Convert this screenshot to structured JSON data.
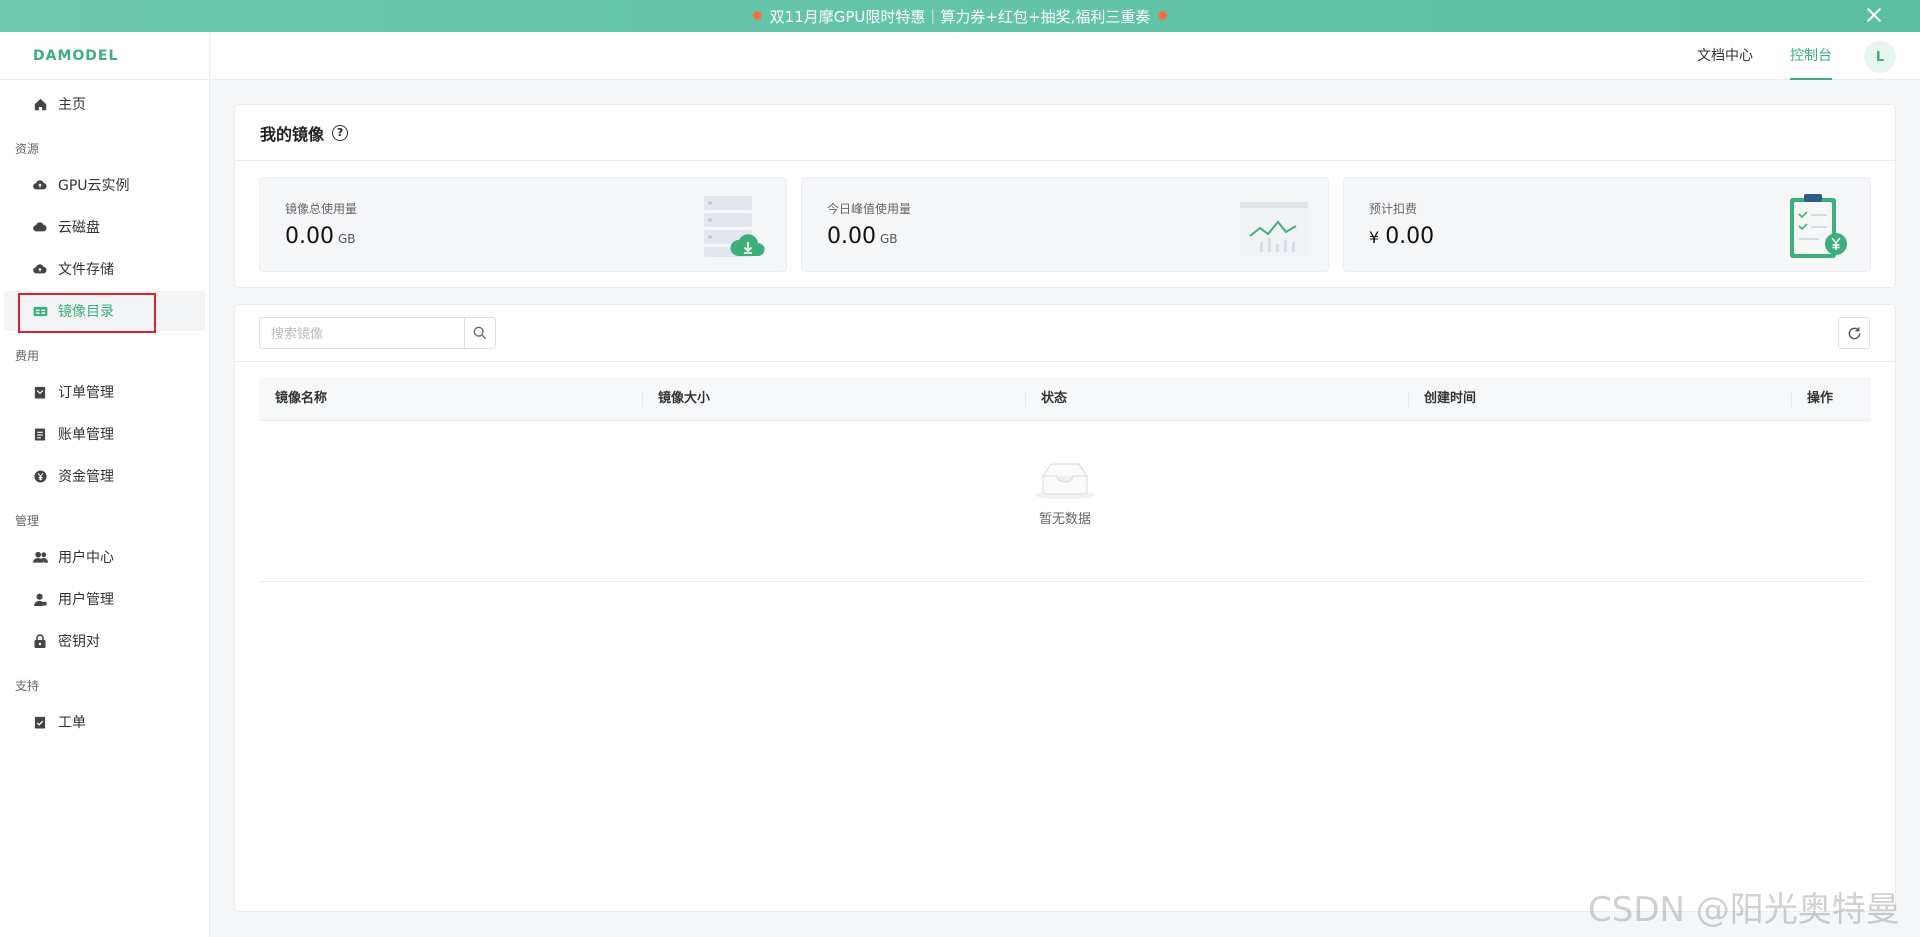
{
  "banner": {
    "text": "双11月摩GPU限时特惠｜算力券+红包+抽奖,福利三重奏"
  },
  "logo": "DAMODEL",
  "sidebar": {
    "home": "主页",
    "sections": {
      "resource": "资源",
      "fee": "费用",
      "manage": "管理",
      "support": "支持"
    },
    "items": {
      "gpu": "GPU云实例",
      "disk": "云磁盘",
      "file": "文件存储",
      "image": "镜像目录",
      "order": "订单管理",
      "bill": "账单管理",
      "fund": "资金管理",
      "user_center": "用户中心",
      "user_manage": "用户管理",
      "keypair": "密钥对",
      "ticket": "工单"
    }
  },
  "topbar": {
    "docs": "文档中心",
    "console": "控制台",
    "avatar": "L"
  },
  "mine": {
    "title": "我的镜像",
    "help": "?",
    "stats": [
      {
        "label": "镜像总使用量",
        "value": "0.00",
        "unit": "GB"
      },
      {
        "label": "今日峰值使用量",
        "value": "0.00",
        "unit": "GB"
      },
      {
        "label": "预计扣费",
        "currency": "¥",
        "value": "0.00"
      }
    ]
  },
  "list": {
    "search_placeholder": "搜索镜像",
    "columns": [
      "镜像名称",
      "镜像大小",
      "状态",
      "创建时间",
      "操作"
    ],
    "empty": "暂无数据"
  },
  "watermark": "CSDN @阳光奥特曼",
  "colors": {
    "accent": "#3eaf7c",
    "banner": "#5bbea0",
    "highlight": "#e0202e"
  }
}
